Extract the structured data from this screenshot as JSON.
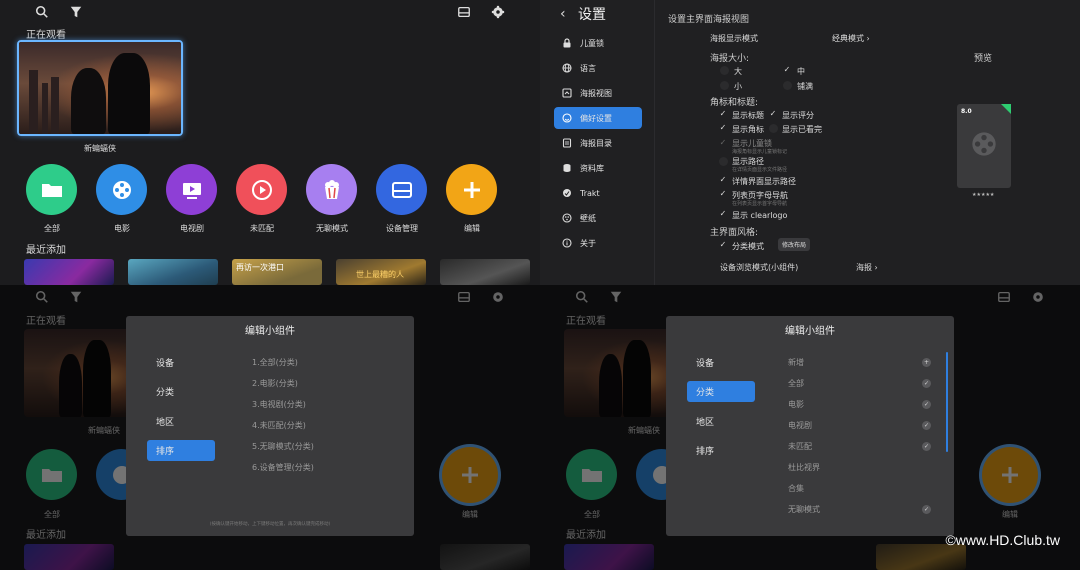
{
  "home": {
    "now_watching": "正在观看",
    "poster_caption": "新蝙蝠侠",
    "recently_added": "最近添加",
    "apps": [
      {
        "label": "全部",
        "icon": "folder-icon",
        "color": "#2ecc8a"
      },
      {
        "label": "电影",
        "icon": "film-reel-icon",
        "color": "#2f8ee6"
      },
      {
        "label": "电视剧",
        "icon": "tv-icon",
        "color": "#8e3fd6"
      },
      {
        "label": "未匹配",
        "icon": "play-circle-icon",
        "color": "#f0505a"
      },
      {
        "label": "无聊模式",
        "icon": "popcorn-icon",
        "color": "#a77ff0"
      },
      {
        "label": "设备管理",
        "icon": "drive-icon",
        "color": "#3367e0"
      },
      {
        "label": "编辑",
        "icon": "plus-icon",
        "color": "#f2a516"
      }
    ],
    "thumb_texts": [
      "再访一次港口",
      "世上最糟的人"
    ]
  },
  "settings": {
    "title": "设置",
    "nav": [
      {
        "label": "儿童锁",
        "icon": "lock-icon"
      },
      {
        "label": "语言",
        "icon": "globe-icon"
      },
      {
        "label": "海报视图",
        "icon": "poster-view-icon"
      },
      {
        "label": "偏好设置",
        "icon": "smile-icon",
        "active": true
      },
      {
        "label": "海报目录",
        "icon": "catalog-icon"
      },
      {
        "label": "资料库",
        "icon": "database-icon"
      },
      {
        "label": "Trakt",
        "icon": "trakt-icon"
      },
      {
        "label": "壁纸",
        "icon": "wallpaper-icon"
      },
      {
        "label": "关于",
        "icon": "info-icon"
      }
    ],
    "heading": "设置主界面海报视图",
    "display_mode_label": "海报显示模式",
    "display_mode_value": "经典模式",
    "poster_size_label": "海报大小:",
    "preview_label": "预览",
    "sizes": [
      "大",
      "中",
      "小",
      "铺满"
    ],
    "corner_label": "角标和标题:",
    "options": {
      "show_title": "显示标题",
      "show_rating": "显示评分",
      "show_badge": "显示角标",
      "show_watched": "显示已看完",
      "show_kids_lock": "显示儿童锁",
      "kids_lock_hint": "海报角标显示儿童锁标记",
      "show_path": "显示路径",
      "path_hint": "在详情页面显示文件路径",
      "detail_path": "详情界面显示路径",
      "list_nav": "列表页字母导航",
      "list_nav_hint": "在列表页显示首字母导航",
      "show_clearlogo": "显示 clearlogo"
    },
    "main_style_label": "主界面风格:",
    "category_mode": "分类模式",
    "edit_layout": "修改布局",
    "device_browse": "设备浏览模式(小组件)",
    "device_browse_value": "海报",
    "preview_rating": "8.0",
    "preview_stars": "★★★★★"
  },
  "dialog_left": {
    "title": "编辑小组件",
    "nav": [
      "设备",
      "分类",
      "地区",
      "排序"
    ],
    "active": "排序",
    "items": [
      "1.全部(分类)",
      "2.电影(分类)",
      "3.电视剧(分类)",
      "4.未匹配(分类)",
      "5.无聊模式(分类)",
      "6.设备管理(分类)"
    ],
    "footnote": "(按确认键开始移动，上下键移动位置，再次确认键完成移动)"
  },
  "dialog_right": {
    "title": "编辑小组件",
    "nav": [
      "设备",
      "分类",
      "地区",
      "排序"
    ],
    "active": "分类",
    "items": [
      {
        "label": "新增",
        "mark": "+"
      },
      {
        "label": "全部",
        "mark": "✓"
      },
      {
        "label": "电影",
        "mark": "✓"
      },
      {
        "label": "电视剧",
        "mark": "✓"
      },
      {
        "label": "未匹配",
        "mark": "✓"
      },
      {
        "label": "杜比视界",
        "mark": ""
      },
      {
        "label": "合集",
        "mark": ""
      },
      {
        "label": "无聊模式",
        "mark": "✓"
      }
    ]
  },
  "watermark": "©www.HD.Club.tw"
}
